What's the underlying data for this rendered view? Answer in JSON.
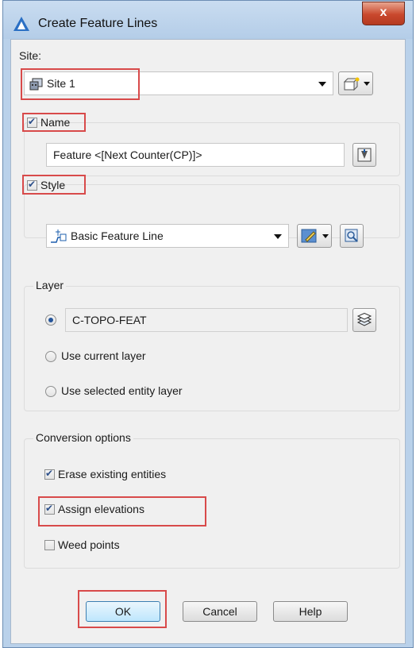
{
  "window": {
    "title": "Create Feature Lines",
    "close_glyph": "x"
  },
  "site": {
    "label": "Site:",
    "value": "Site 1"
  },
  "name": {
    "label": "Name",
    "checked": true,
    "value": "Feature <[Next Counter(CP)]>"
  },
  "style": {
    "label": "Style",
    "checked": true,
    "value": "Basic Feature Line"
  },
  "layer": {
    "group_label": "Layer",
    "options": [
      {
        "label": "C-TOPO-FEAT",
        "selected": true
      },
      {
        "label": "Use current layer",
        "selected": false
      },
      {
        "label": "Use selected entity layer",
        "selected": false
      }
    ]
  },
  "conversion": {
    "group_label": "Conversion options",
    "erase": {
      "label": "Erase existing entities",
      "checked": true
    },
    "assign": {
      "label": "Assign elevations",
      "checked": true
    },
    "weed": {
      "label": "Weed points",
      "checked": false
    }
  },
  "buttons": {
    "ok": "OK",
    "cancel": "Cancel",
    "help": "Help"
  },
  "icons": {
    "title": "autodesk-civil3d-icon",
    "site": "site-icon",
    "create_site": "create-site-icon",
    "name_edit": "edit-name-template-icon",
    "style": "feature-line-style-icon",
    "style_edit": "edit-style-icon",
    "style_preview": "preview-style-icon",
    "layer": "layer-stack-icon"
  },
  "colors": {
    "highlight": "#d84a4a",
    "title_bg": "#b9d1ea",
    "close_bg": "#c9482d"
  }
}
